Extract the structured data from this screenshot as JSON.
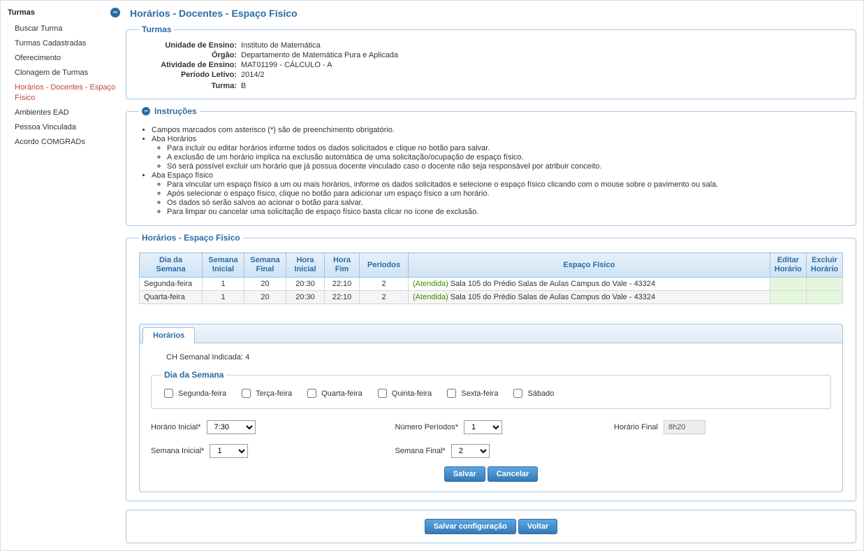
{
  "sidebar": {
    "title": "Turmas",
    "items": [
      {
        "label": "Buscar Turma"
      },
      {
        "label": "Turmas Cadastradas"
      },
      {
        "label": "Oferecimento"
      },
      {
        "label": "Clonagem de Turmas"
      },
      {
        "label": "Horários - Docentes - Espaço Físico"
      },
      {
        "label": "Ambientes EAD"
      },
      {
        "label": "Pessoa Vinculada"
      },
      {
        "label": "Acordo COMGRADs"
      }
    ]
  },
  "page_title": "Horários - Docentes - Espaço Físico",
  "turma_panel": {
    "legend": "Turmas",
    "labels": {
      "unidade": "Unidade de Ensino:",
      "orgao": "Órgão:",
      "atividade": "Atividade de Ensino:",
      "periodo": "Período Letivo:",
      "turma": "Turma:"
    },
    "values": {
      "unidade": "Instituto de Matemática",
      "orgao": "Departamento de Matemática Pura e Aplicada",
      "atividade": "MAT01199 - CÁLCULO - A",
      "periodo": "2014/2",
      "turma": "B"
    }
  },
  "instrucoes": {
    "legend": "Instruções",
    "items_top": [
      "Campos marcados com asterisco (*) são de preenchimento obrigatório.",
      "Aba Horários"
    ],
    "items_horarios": [
      "Para incluir ou editar horários informe todos os dados solicitados e clique no botão para salvar.",
      "A exclusão de um horário implica na exclusão automática de uma solicitação/ocupação de espaço físico.",
      "Só será possível excluir um horário que já possua docente vinculado caso o docente não seja responsável por atribuir conceito."
    ],
    "items_aba_espaco": "Aba Espaço físico",
    "items_espaco": [
      "Para vincular um espaço físico a um ou mais horários, informe os dados solicitados e selecione o espaço físico clicando com o mouse sobre o pavimento ou sala.",
      "Após selecionar o espaço físico, clique no botão para adicionar um espaço físico a um horário.",
      "Os dados só serão salvos ao acionar o botão para salvar.",
      "Para limpar ou cancelar uma solicitação de espaço físico basta clicar no ícone de exclusão."
    ]
  },
  "horarios_panel": {
    "legend": "Horários - Espaço Físico",
    "headers": {
      "dia": "Dia da Semana",
      "sem_ini": "Semana Inicial",
      "sem_fim": "Semana Final",
      "h_ini": "Hora Inicial",
      "h_fim": "Hora Fim",
      "periodos": "Períodos",
      "espaco": "Espaço Físico",
      "editar": "Editar Horário",
      "excluir": "Excluir Horário"
    },
    "rows": [
      {
        "dia": "Segunda-feira",
        "sem_ini": "1",
        "sem_fim": "20",
        "h_ini": "20:30",
        "h_fim": "22:10",
        "periodos": "2",
        "status": "(Atendida)",
        "espaco": "Sala 105 do Prédio Salas de Aulas Campus do Vale - 43324"
      },
      {
        "dia": "Quarta-feira",
        "sem_ini": "1",
        "sem_fim": "20",
        "h_ini": "20:30",
        "h_fim": "22:10",
        "periodos": "2",
        "status": "(Atendida)",
        "espaco": "Sala 105 do Prédio Salas de Aulas Campus do Vale - 43324"
      }
    ]
  },
  "tab": {
    "label": "Horários",
    "ch_line": "CH Semanal Indicada: 4",
    "dia_legend": "Dia da Semana",
    "days": [
      "Segunda-feira",
      "Terça-feira",
      "Quarta-feira",
      "Quinta-feira",
      "Sexta-feira",
      "Sábado"
    ],
    "labels": {
      "hora_ini": "Horário Inicial*",
      "sem_ini": "Semana Inicial*",
      "num_per": "Número Períodos*",
      "sem_fim": "Semana Final*",
      "hora_fim": "Horário Final"
    },
    "values": {
      "hora_ini": "7:30",
      "sem_ini": "1",
      "num_per": "1",
      "sem_fim": "2",
      "hora_fim": "8h20"
    },
    "buttons": {
      "salvar": "Salvar",
      "cancelar": "Cancelar"
    }
  },
  "footer": {
    "salvar_config": "Salvar configuração",
    "voltar": "Voltar"
  }
}
